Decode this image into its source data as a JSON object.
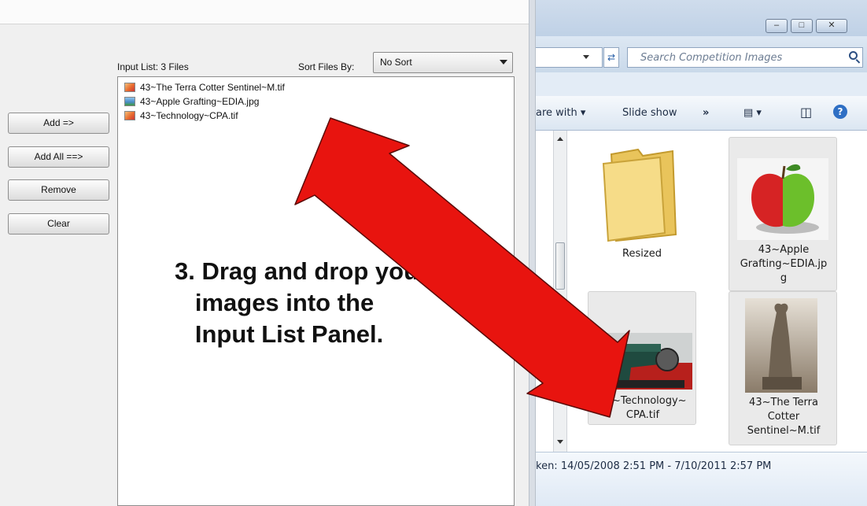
{
  "left_panel": {
    "input_list_label": "Input List: 3 Files",
    "sort_label": "Sort Files By:",
    "sort_value": "No Sort",
    "files": [
      {
        "name": "43~The Terra Cotter Sentinel~M.tif",
        "type": "tif"
      },
      {
        "name": "43~Apple Grafting~EDIA.jpg",
        "type": "jpg"
      },
      {
        "name": "43~Technology~CPA.tif",
        "type": "tif"
      }
    ],
    "buttons": {
      "add": "Add =>",
      "add_all": "Add All ==>",
      "remove": "Remove",
      "clear": "Clear"
    }
  },
  "explorer": {
    "window_buttons": {
      "minimize": "–",
      "maximize": "□",
      "close": "✕"
    },
    "refresh_icon": "⇄",
    "search_placeholder": "Search Competition Images",
    "toolbar": {
      "share": "are with ▾",
      "slideshow": "Slide show",
      "more": "»",
      "views": "▤ ▾",
      "pane": "◫",
      "help": "?"
    },
    "items": [
      {
        "label": "Resized",
        "kind": "folder"
      },
      {
        "label": "43~Apple\nGrafting~EDIA.jp\ng",
        "kind": "apple"
      },
      {
        "label": "43~Technology~\nCPA.tif",
        "kind": "sewing-machine"
      },
      {
        "label": "43~The Terra\nCotter\nSentinel~M.tif",
        "kind": "statue"
      }
    ],
    "date_taken": "ken: 14/05/2008 2:51 PM - 7/10/2011 2:57 PM"
  },
  "annotation": {
    "text": "3. Drag and drop your\n   images into the\n   Input List Panel.",
    "arrow_color": "#e8140f"
  }
}
